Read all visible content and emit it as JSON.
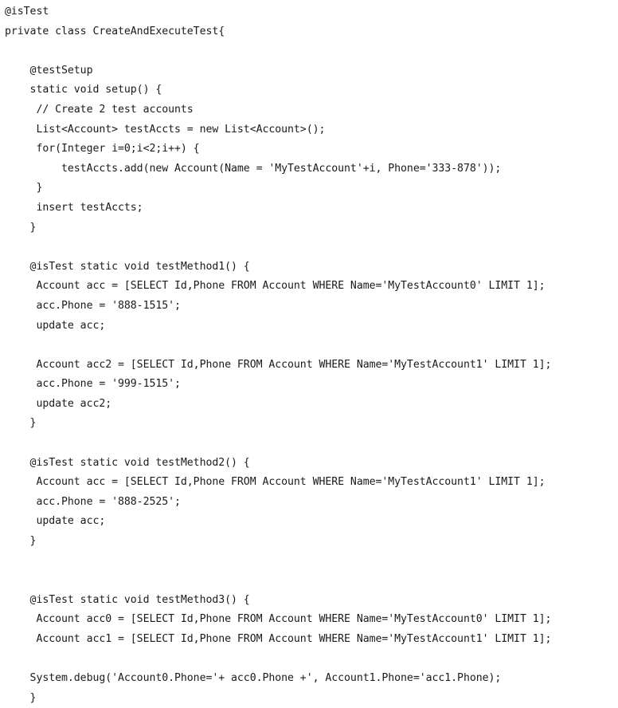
{
  "document": {
    "kind": "source-code-screenshot",
    "language": "Apex",
    "background_color": "#ffffff",
    "text_color": "#1a1a1a",
    "class_name": "CreateAndExecuteTest",
    "code_lines": [
      "@isTest",
      "private class CreateAndExecuteTest{",
      "",
      "    @testSetup",
      "    static void setup() {",
      "     // Create 2 test accounts",
      "     List<Account> testAccts = new List<Account>();",
      "     for(Integer i=0;i<2;i++) {",
      "         testAccts.add(new Account(Name = 'MyTestAccount'+i, Phone='333-878'));",
      "     }",
      "     insert testAccts;",
      "    }",
      "",
      "    @isTest static void testMethod1() {",
      "     Account acc = [SELECT Id,Phone FROM Account WHERE Name='MyTestAccount0' LIMIT 1];",
      "     acc.Phone = '888-1515';",
      "     update acc;",
      "",
      "     Account acc2 = [SELECT Id,Phone FROM Account WHERE Name='MyTestAccount1' LIMIT 1];",
      "     acc.Phone = '999-1515';",
      "     update acc2;",
      "    }",
      "",
      "    @isTest static void testMethod2() {",
      "     Account acc = [SELECT Id,Phone FROM Account WHERE Name='MyTestAccount1' LIMIT 1];",
      "     acc.Phone = '888-2525';",
      "     update acc;",
      "    }",
      "",
      "",
      "    @isTest static void testMethod3() {",
      "     Account acc0 = [SELECT Id,Phone FROM Account WHERE Name='MyTestAccount0' LIMIT 1];",
      "     Account acc1 = [SELECT Id,Phone FROM Account WHERE Name='MyTestAccount1' LIMIT 1];",
      "",
      "    System.debug('Account0.Phone='+ acc0.Phone +', Account1.Phone='acc1.Phone);",
      "    }"
    ]
  }
}
